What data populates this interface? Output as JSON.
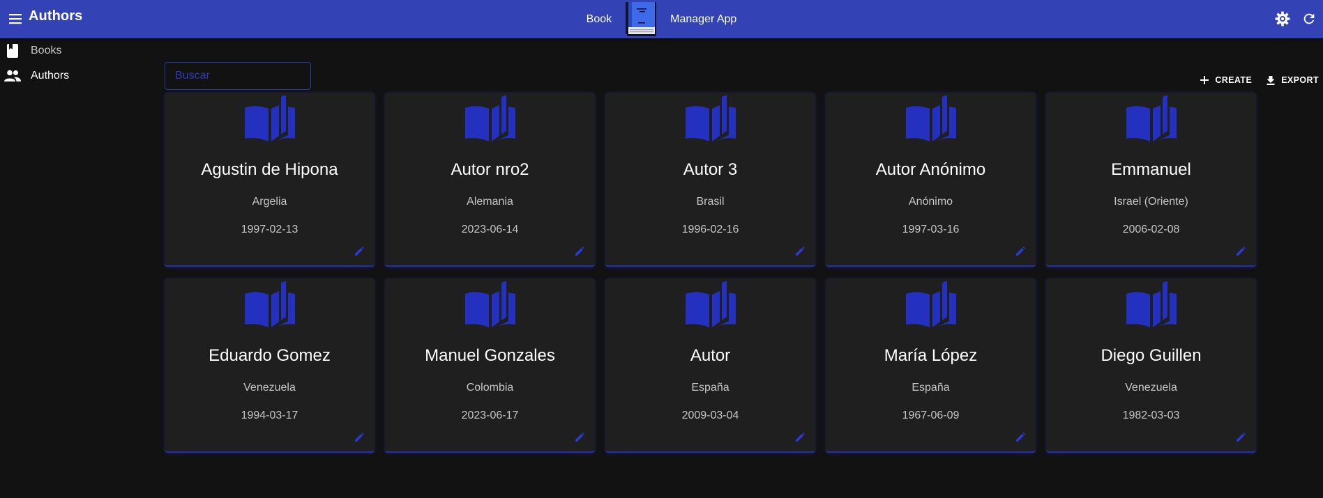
{
  "appbar": {
    "title": "Authors",
    "brand_left": "Book",
    "brand_right": "Manager App",
    "icons": {
      "menu": "menu-icon",
      "logo": "book-manager-logo",
      "settings": "settings-gear-icon",
      "refresh": "refresh-icon"
    }
  },
  "sidebar": {
    "items": [
      {
        "label": "Books",
        "icon": "book-icon",
        "active": false
      },
      {
        "label": "Authors",
        "icon": "people-icon",
        "active": true
      }
    ]
  },
  "toolbar": {
    "search_placeholder": "Buscar",
    "create_label": "CREATE",
    "export_label": "EXPORT"
  },
  "colors": {
    "appbar": "#3342b4",
    "background": "#121212",
    "card": "#1f1f1f",
    "accent": "#2430c0"
  },
  "authors": [
    {
      "name": "Agustin de Hipona",
      "country": "Argelia",
      "date": "1997-02-13"
    },
    {
      "name": "Autor nro2",
      "country": "Alemania",
      "date": "2023-06-14"
    },
    {
      "name": "Autor 3",
      "country": "Brasil",
      "date": "1996-02-16"
    },
    {
      "name": "Autor Anónimo",
      "country": "Anónimo",
      "date": "1997-03-16"
    },
    {
      "name": "Emmanuel",
      "country": "Israel (Oriente)",
      "date": "2006-02-08"
    },
    {
      "name": "Eduardo Gomez",
      "country": "Venezuela",
      "date": "1994-03-17"
    },
    {
      "name": "Manuel Gonzales",
      "country": "Colombia",
      "date": "2023-06-17"
    },
    {
      "name": "Autor",
      "country": "España",
      "date": "2009-03-04"
    },
    {
      "name": "María López",
      "country": "España",
      "date": "1967-06-09"
    },
    {
      "name": "Diego Guillen",
      "country": "Venezuela",
      "date": "1982-03-03"
    }
  ]
}
